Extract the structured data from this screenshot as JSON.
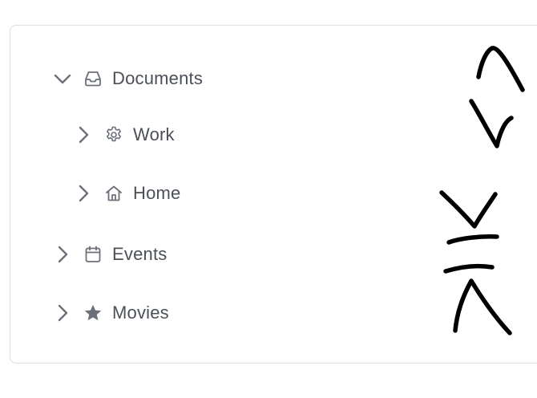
{
  "tree": {
    "items": [
      {
        "label": "Documents",
        "icon": "inbox-icon",
        "expanded": true,
        "level": 0
      },
      {
        "label": "Work",
        "icon": "gear-icon",
        "expanded": false,
        "level": 1
      },
      {
        "label": "Home",
        "icon": "home-icon",
        "expanded": false,
        "level": 1
      },
      {
        "label": "Events",
        "icon": "calendar-icon",
        "expanded": false,
        "level": 0
      },
      {
        "label": "Movies",
        "icon": "star-icon",
        "expanded": false,
        "level": 0
      }
    ]
  },
  "colors": {
    "text": "#4b5057",
    "icon": "#6b7079",
    "border": "#dcdfe3",
    "scribble": "#000000"
  }
}
